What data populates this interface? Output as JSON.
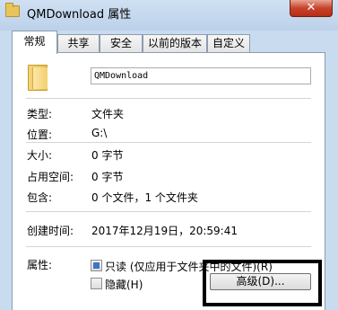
{
  "window": {
    "title": "QMDownload 属性",
    "close_glyph": "✕"
  },
  "tabs": [
    {
      "label": "常规",
      "active": true
    },
    {
      "label": "共享",
      "active": false
    },
    {
      "label": "安全",
      "active": false
    },
    {
      "label": "以前的版本",
      "active": false
    },
    {
      "label": "自定义",
      "active": false
    }
  ],
  "general": {
    "folder_name": "QMDownload",
    "fields": {
      "type": {
        "label": "类型:",
        "value": "文件夹"
      },
      "location": {
        "label": "位置:",
        "value": "G:\\"
      },
      "size": {
        "label": "大小:",
        "value": "0 字节"
      },
      "size_on_disk": {
        "label": "占用空间:",
        "value": "0 字节"
      },
      "contains": {
        "label": "包含:",
        "value": "0 个文件，1 个文件夹"
      },
      "created": {
        "label": "创建时间:",
        "value": "2017年12月19日，20:59:41"
      }
    },
    "attributes": {
      "label": "属性:",
      "readonly_label": "只读 (仅应用于文件夹中的文件)(R)",
      "readonly_state": "indeterminate",
      "hidden_label": "隐藏(H)",
      "hidden_state": "unchecked",
      "advanced_button": "高级(D)..."
    }
  },
  "colors": {
    "window_frame": "#c9dbef",
    "close_button": "#c7432c",
    "checkbox_fill": "#3f73c6",
    "annotation_box": "#000000"
  },
  "icons": {
    "app": "folder-icon",
    "main": "folder-icon",
    "close": "close-icon"
  }
}
